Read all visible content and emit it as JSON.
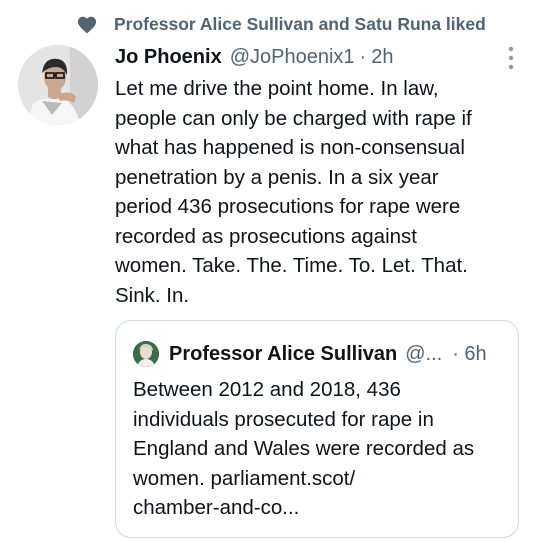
{
  "liked_by": {
    "text": "Professor Alice Sullivan and Satu Runa liked"
  },
  "tweet": {
    "author_name": "Jo Phoenix",
    "handle": "@JoPhoenix1",
    "separator": "·",
    "time": "2h",
    "body_lines": [
      "Let me drive the point home. In law,",
      "people can only be charged with rape if",
      "what has happened is non-consensual",
      "penetration by a penis. In a six year",
      "period 436 prosecutions for rape were",
      "recorded as prosecutions against",
      "women. Take. The. Time. To. Let. That.",
      "Sink. In."
    ]
  },
  "quoted_tweet": {
    "author_name": "Professor Alice Sullivan",
    "handle": "@...",
    "time": "· 6h",
    "body_lines": [
      "Between 2012 and 2018, 436",
      "individuals prosecuted for rape in",
      "England and Wales were recorded as",
      "women. parliament.scot/",
      "chamber-and-co..."
    ]
  },
  "colors": {
    "text_primary": "#0f1419",
    "text_secondary": "#536471",
    "border": "#cfd9de",
    "heart": "#536471"
  },
  "icons": {
    "liked": "heart-icon",
    "more": "more-vertical-icon"
  }
}
